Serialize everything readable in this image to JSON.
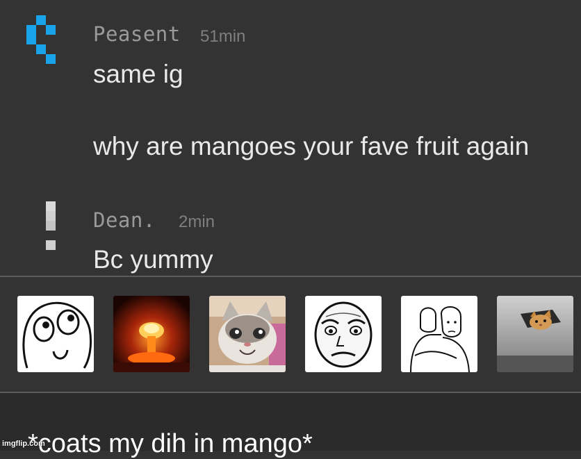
{
  "messages": [
    {
      "author": "Peasent",
      "time": "51min",
      "avatar_icon": "pixel-blue-avatar-icon",
      "avatar_color": "#1aa3e8",
      "lines": [
        "same ig",
        "why are mangoes your fave fruit again"
      ]
    },
    {
      "author": "Dean.",
      "time": "2min",
      "avatar_icon": "pixel-white-avatar-icon",
      "avatar_color": "#d9d9d9",
      "lines": [
        "Bc yummy"
      ]
    }
  ],
  "reaction_tray": {
    "items": [
      {
        "name": "derp-face-meme"
      },
      {
        "name": "nuclear-explosion-meme"
      },
      {
        "name": "smiling-cat-meme"
      },
      {
        "name": "okay-face-meme"
      },
      {
        "name": "wojak-hug-meme"
      },
      {
        "name": "ceiling-cat-meme"
      }
    ]
  },
  "caption": "*coats my dih in mango*",
  "watermark": "imgflip.com",
  "colors": {
    "background": "#333333",
    "divider": "#5c5c5c",
    "text": "#e9e9e9",
    "muted": "#9a9a9a"
  }
}
